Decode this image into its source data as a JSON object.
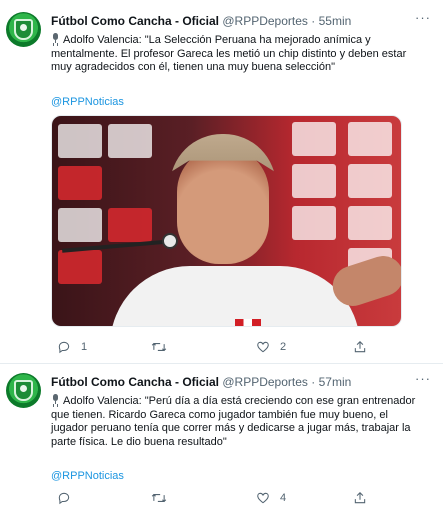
{
  "tweets": [
    {
      "author_name": "Fútbol Como Cancha - Oficial",
      "handle": "@RPPDeportes",
      "separator": "·",
      "time": "55min",
      "more": "···",
      "speaker": "Adolfo Valencia:",
      "text": "\"La Selección Peruana ha mejorado anímica y mentalmente. El profesor Gareca les metió un chip distinto y deben estar muy agradecidos con él, tienen una muy buena selección\"",
      "mention": "@RPPNoticias",
      "replies": "1",
      "retweets": "",
      "likes": "2"
    },
    {
      "author_name": "Fútbol Como Cancha - Oficial",
      "handle": "@RPPDeportes",
      "separator": "·",
      "time": "57min",
      "more": "···",
      "speaker": "Adolfo Valencia:",
      "text": "\"Perú día a día está creciendo con ese gran entrenador que tienen. Ricardo Gareca como jugador también fue muy bueno, el jugador peruano tenía que correr más y dedicarse a jugar más, trabajar la parte física. Le dio buena resultado\"",
      "mention": "@RPPNoticias",
      "replies": "",
      "retweets": "",
      "likes": "4"
    }
  ],
  "icons": {
    "reply": "reply-icon",
    "retweet": "retweet-icon",
    "like": "heart-icon",
    "share": "share-icon",
    "speaker": "microphone-icon"
  },
  "colors": {
    "link": "#1b95e0",
    "secondary_text": "#536471",
    "avatar_green": "#2fb54a"
  }
}
